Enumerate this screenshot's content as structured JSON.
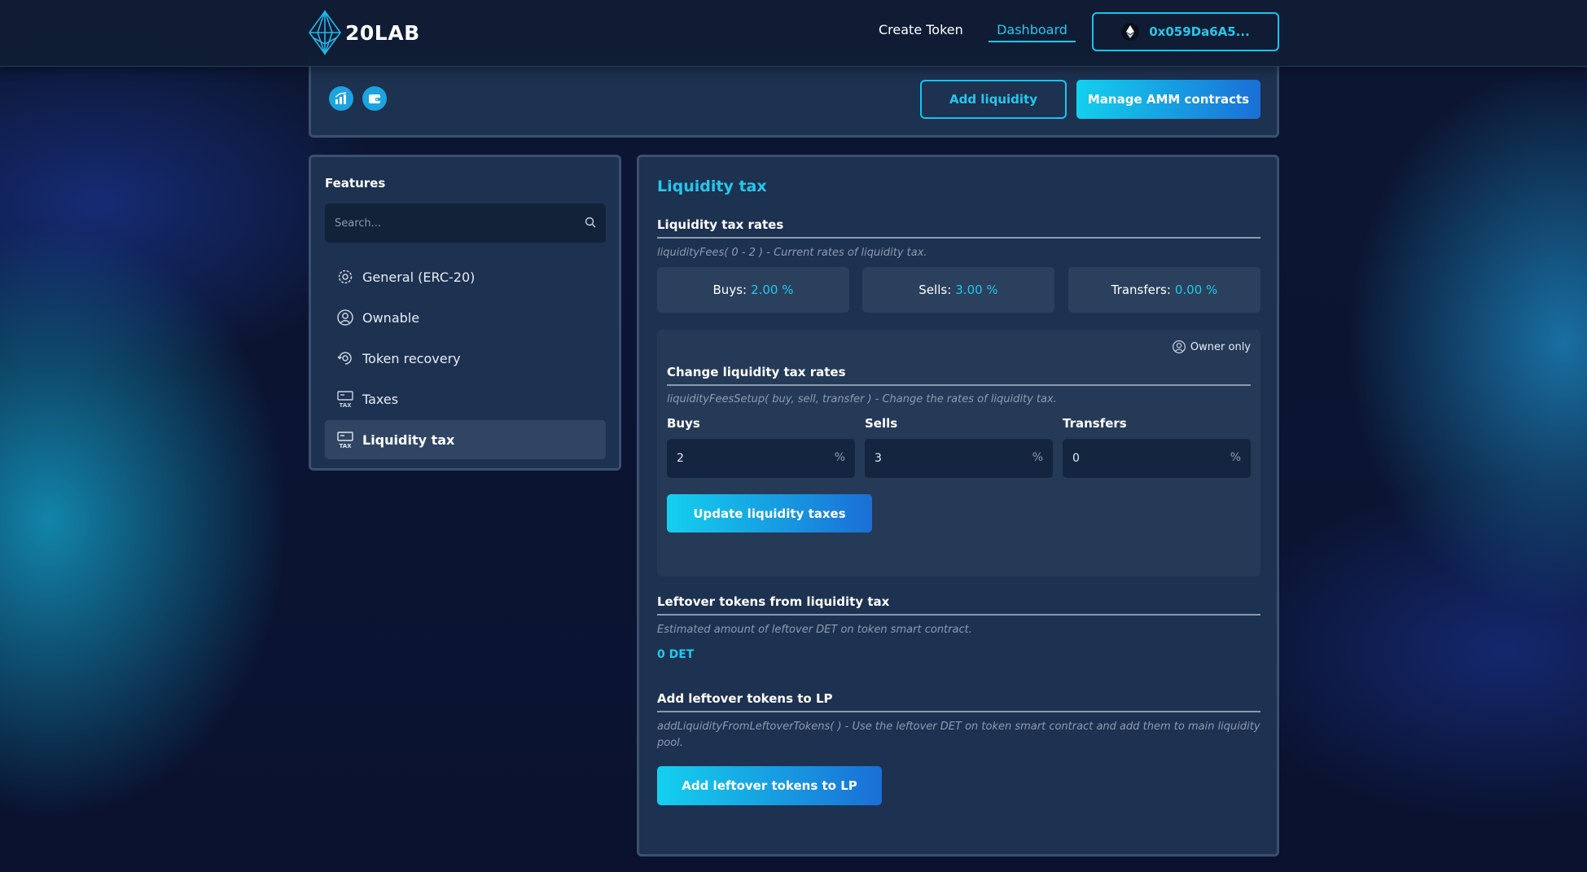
{
  "header": {
    "logo_text": "20LAB",
    "nav": [
      {
        "label": "Create Token"
      },
      {
        "label": "Dashboard"
      }
    ],
    "wallet_address": "0x059Da6A5..."
  },
  "top_actions": {
    "add_liquidity_label": "Add liquidity",
    "manage_amm_label": "Manage AMM contracts"
  },
  "sidebar": {
    "title": "Features",
    "search_placeholder": "Search...",
    "items": [
      {
        "label": "General (ERC-20)",
        "icon": "gear-icon"
      },
      {
        "label": "Ownable",
        "icon": "user-circle-icon"
      },
      {
        "label": "Token recovery",
        "icon": "recovery-icon"
      },
      {
        "label": "Taxes",
        "icon": "tax-icon"
      },
      {
        "label": "Liquidity tax",
        "icon": "tax-icon",
        "active": true
      }
    ]
  },
  "main": {
    "title": "Liquidity tax",
    "rates": {
      "title": "Liquidity tax rates",
      "description": "liquidityFees( 0 - 2 ) - Current rates of liquidity tax.",
      "items": [
        {
          "label": "Buys:",
          "value": "2.00 %"
        },
        {
          "label": "Sells:",
          "value": "3.00 %"
        },
        {
          "label": "Transfers:",
          "value": "0.00 %"
        }
      ]
    },
    "change": {
      "owner_label": "Owner only",
      "title": "Change liquidity tax rates",
      "description": "liquidityFeesSetup( buy, sell, transfer ) - Change the rates of liquidity tax.",
      "fields": [
        {
          "label": "Buys",
          "value": "2",
          "unit": "%"
        },
        {
          "label": "Sells",
          "value": "3",
          "unit": "%"
        },
        {
          "label": "Transfers",
          "value": "0",
          "unit": "%"
        }
      ],
      "button_label": "Update liquidity taxes"
    },
    "leftover": {
      "title": "Leftover tokens from liquidity tax",
      "description": "Estimated amount of leftover DET on token smart contract.",
      "value": "0 DET"
    },
    "add_lp": {
      "title": "Add leftover tokens to LP",
      "description": "addLiquidityFromLeftoverTokens( ) - Use the leftover DET on token smart contract and add them to main liquidity pool.",
      "button_label": "Add leftover tokens to LP"
    }
  },
  "colors": {
    "accent": "#25c7ea",
    "gradient_start": "#14d0ee",
    "gradient_end": "#1a6fd6",
    "panel": "#1d3150"
  }
}
